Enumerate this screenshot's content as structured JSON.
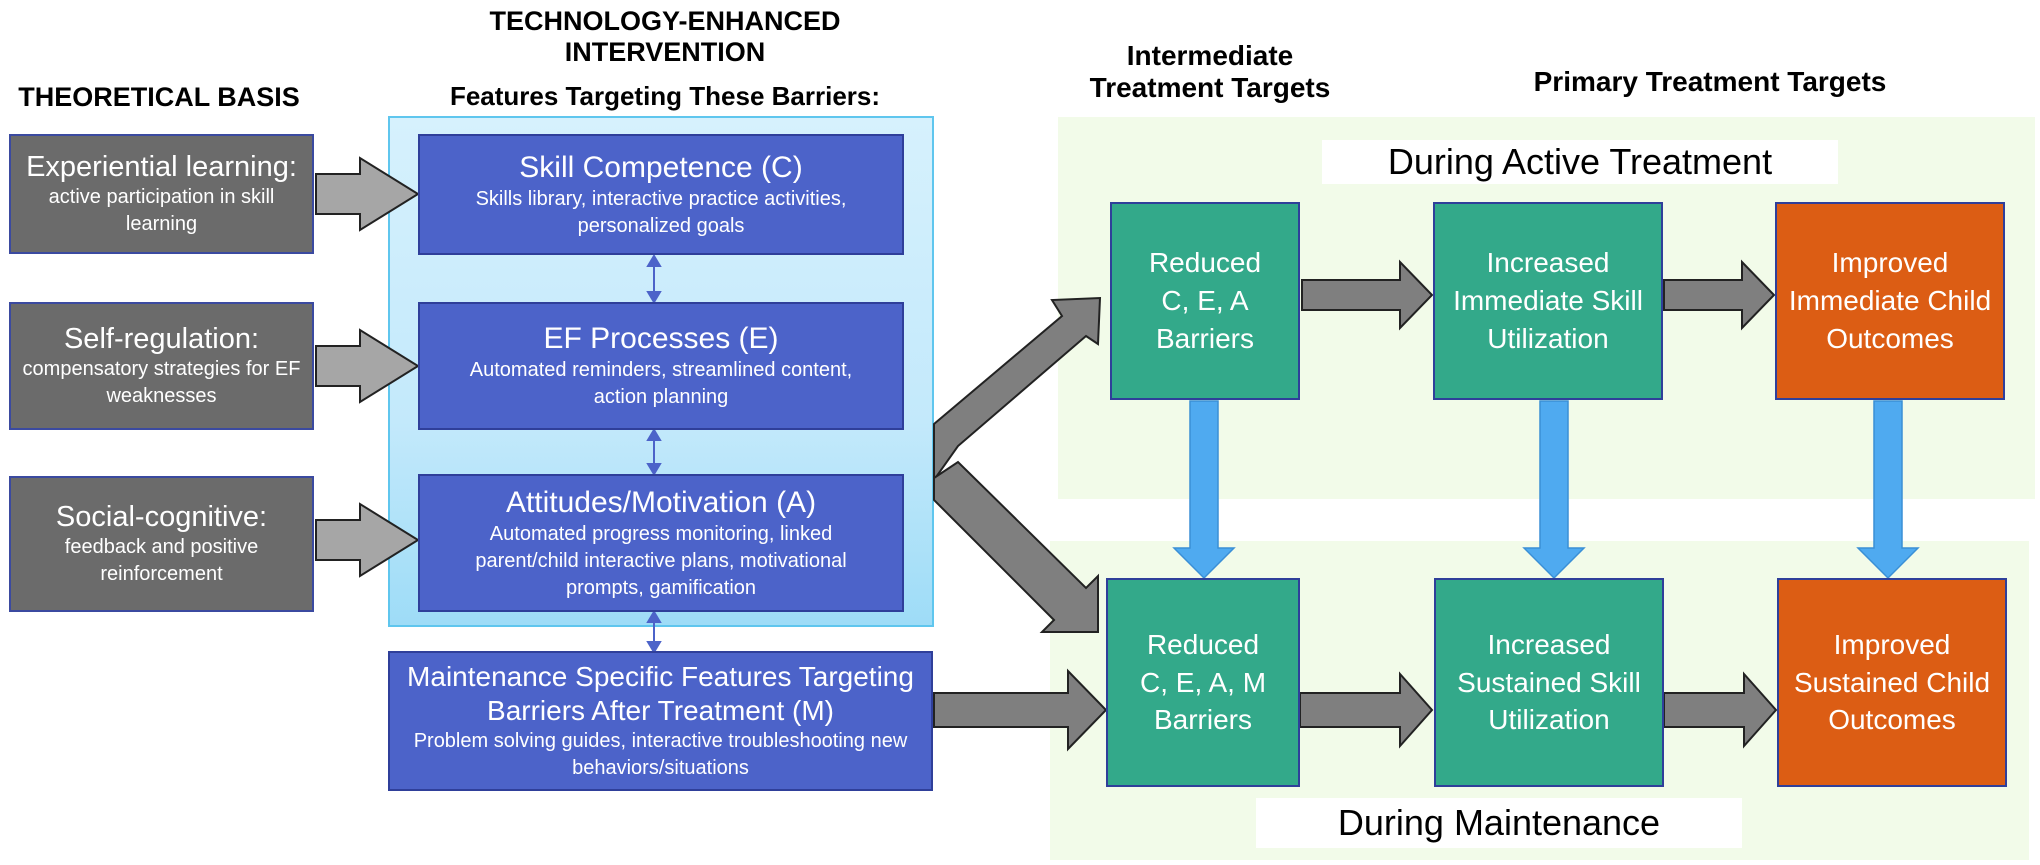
{
  "headers": {
    "theoretical_basis": "THEORETICAL BASIS",
    "intervention_line1": "TECHNOLOGY-ENHANCED",
    "intervention_line2": "INTERVENTION",
    "features_subtitle": "Features Targeting These Barriers:",
    "intermediate_line1": "Intermediate",
    "intermediate_line2": "Treatment Targets",
    "primary": "Primary Treatment Targets"
  },
  "theories": [
    {
      "title": "Experiential learning:",
      "desc": "active participation in skill learning"
    },
    {
      "title": "Self-regulation:",
      "desc": "compensatory strategies for EF weaknesses"
    },
    {
      "title": "Social-cognitive:",
      "desc": "feedback and positive reinforcement"
    }
  ],
  "features": [
    {
      "title": "Skill Competence (C)",
      "desc": "Skills library, interactive practice activities, personalized goals"
    },
    {
      "title": "EF Processes (E)",
      "desc": "Automated reminders, streamlined content, action planning"
    },
    {
      "title": "Attitudes/Motivation (A)",
      "desc": "Automated progress monitoring, linked parent/child interactive plans, motivational prompts, gamification"
    }
  ],
  "maintenance_feature": {
    "title": "Maintenance Specific Features Targeting Barriers After Treatment (M)",
    "desc": "Problem solving guides, interactive troubleshooting new behaviors/situations"
  },
  "zones": {
    "active": "During Active Treatment",
    "maintenance": "During Maintenance"
  },
  "active_targets": [
    {
      "line1": "Reduced",
      "line2": "C, E, A",
      "line3": "Barriers"
    },
    {
      "line1": "Increased",
      "line2": "Immediate Skill",
      "line3": "Utilization"
    },
    {
      "line1": "Improved",
      "line2": "Immediate Child",
      "line3": "Outcomes"
    }
  ],
  "maintenance_targets": [
    {
      "line1": "Reduced",
      "line2": "C, E, A, M",
      "line3": "Barriers"
    },
    {
      "line1": "Increased",
      "line2": "Sustained Skill",
      "line3": "Utilization"
    },
    {
      "line1": "Improved",
      "line2": "Sustained Child",
      "line3": "Outcomes"
    }
  ],
  "colors": {
    "theory_box": "#6b6b6b",
    "feature_box": "#4c63c9",
    "intermediate_box": "#33a98a",
    "outcome_box": "#dc5d14",
    "container": "#c9ecfb",
    "zone_bg": "#f2fbe9",
    "gray_arrow": "#7f7f7f",
    "blue_arrow": "#4faaf0"
  }
}
